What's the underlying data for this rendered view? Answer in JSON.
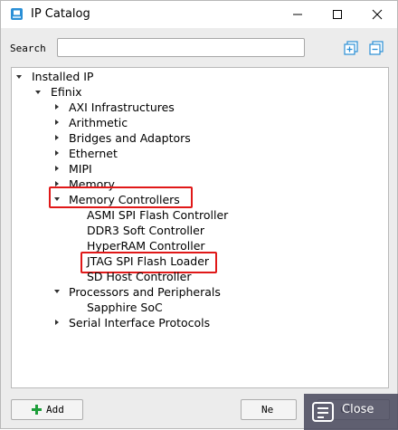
{
  "window": {
    "title": "IP Catalog",
    "minimize_icon": "minimize-icon",
    "maximize_icon": "maximize-icon",
    "close_icon": "close-icon"
  },
  "search": {
    "label": "Search",
    "value": "",
    "placeholder": ""
  },
  "toolbar": {
    "expand_all_icon": "expand-all-icon",
    "collapse_all_icon": "collapse-all-icon"
  },
  "tree": {
    "root": "Installed IP",
    "vendor": "Efinix",
    "categories": [
      {
        "label": "AXI Infrastructures",
        "expanded": false
      },
      {
        "label": "Arithmetic",
        "expanded": false
      },
      {
        "label": "Bridges and Adaptors",
        "expanded": false
      },
      {
        "label": "Ethernet",
        "expanded": false
      },
      {
        "label": "MIPI",
        "expanded": false
      },
      {
        "label": "Memory",
        "expanded": false
      },
      {
        "label": "Memory Controllers",
        "expanded": true,
        "highlighted": true,
        "children": [
          "ASMI SPI Flash Controller",
          "DDR3 Soft Controller",
          "HyperRAM Controller",
          "JTAG SPI Flash Loader",
          "SD Host Controller"
        ],
        "highlighted_child": "JTAG SPI Flash Loader"
      },
      {
        "label": "Processors and Peripherals",
        "expanded": true,
        "children": [
          "Sapphire SoC"
        ]
      },
      {
        "label": "Serial Interface Protocols",
        "expanded": false
      }
    ]
  },
  "buttons": {
    "add": "Add",
    "next": "Ne",
    "close": "Close"
  },
  "colors": {
    "highlight": "#e01818",
    "window_bg": "#ececec",
    "accent_icon": "#2a8fd6",
    "add_icon": "#1d9e3a"
  }
}
